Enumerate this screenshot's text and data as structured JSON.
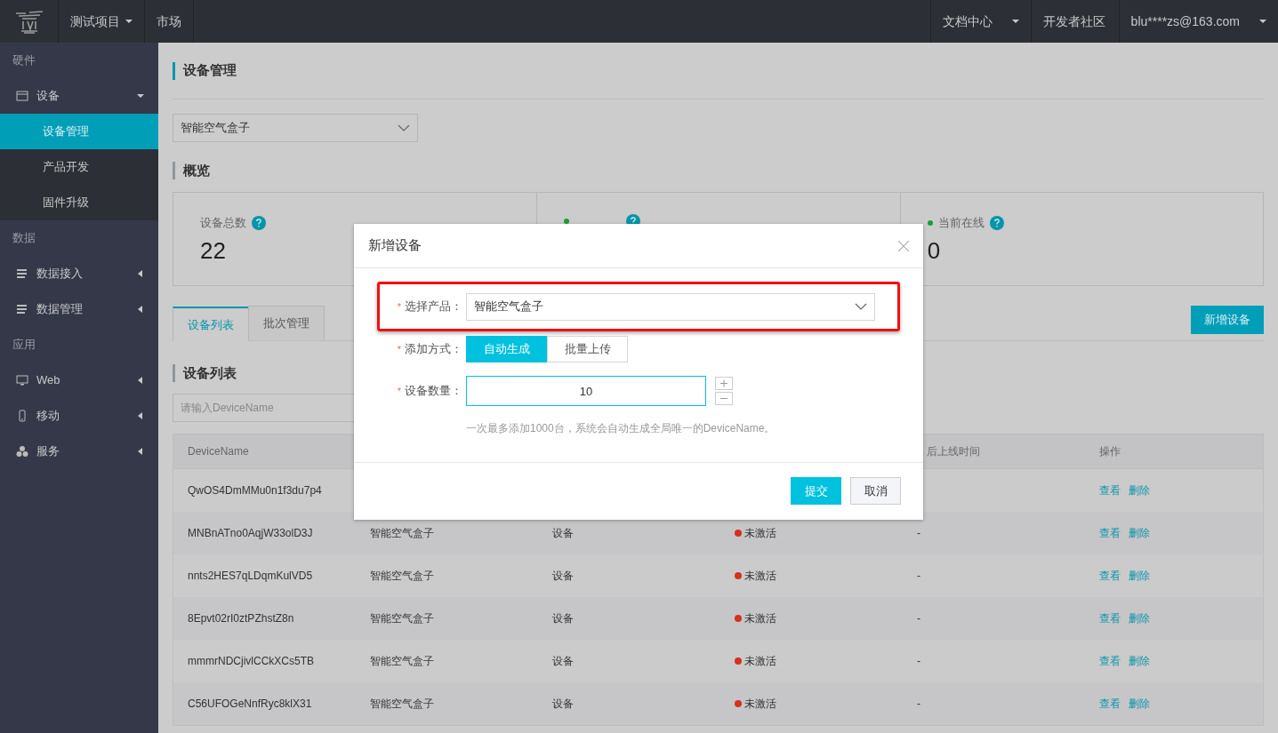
{
  "topbar": {
    "nav": [
      {
        "label": "测试项目",
        "dropdown": true
      },
      {
        "label": "市场",
        "dropdown": false
      }
    ],
    "right": [
      {
        "label": "文档中心",
        "dropdown": true
      },
      {
        "label": "开发者社区",
        "dropdown": false
      },
      {
        "label": "blu****zs@163.com",
        "dropdown": true
      }
    ]
  },
  "sidebar": {
    "sections": [
      {
        "title": "硬件",
        "items": [
          {
            "label": "设备",
            "kind": "window",
            "expanded": true,
            "children": [
              {
                "label": "设备管理",
                "selected": true
              },
              {
                "label": "产品开发",
                "selected": false
              },
              {
                "label": "固件升级",
                "selected": false
              }
            ]
          }
        ]
      },
      {
        "title": "数据",
        "items": [
          {
            "label": "数据接入",
            "kind": "list",
            "expanded": false
          },
          {
            "label": "数据管理",
            "kind": "list",
            "expanded": false
          }
        ]
      },
      {
        "title": "应用",
        "items": [
          {
            "label": "Web",
            "kind": "monitor",
            "expanded": false
          },
          {
            "label": "移动",
            "kind": "phone",
            "expanded": false
          },
          {
            "label": "服务",
            "kind": "cluster",
            "expanded": false
          }
        ]
      }
    ]
  },
  "page": {
    "title": "设备管理",
    "product_select": "智能空气盒子",
    "overview_title": "概览",
    "stats": [
      {
        "label": "设备总数",
        "value": "22"
      },
      {
        "color": "#17a03a"
      },
      {
        "label": "当前在线",
        "value": "0",
        "color": "#17a03a"
      }
    ],
    "tabs": [
      {
        "label": "设备列表",
        "selected": true
      },
      {
        "label": "批次管理",
        "selected": false
      }
    ],
    "add_button": "新增设备",
    "list_title": "设备列表",
    "search_placeholder": "请输入DeviceName",
    "table": {
      "columns": [
        "DeviceName",
        "",
        "",
        "",
        "后上线时间",
        "操作"
      ],
      "rows": [
        {
          "device_name": "QwOS4DmMMu0n1f3du7p4",
          "actions": [
            "查看",
            "删除"
          ]
        },
        {
          "device_name": "MNBnATno0AqjW33olD3J",
          "product": "智能空气盒子",
          "node_type": "设备",
          "status": "未激活",
          "color": "#d8301c",
          "last_online": "-",
          "actions": [
            "查看",
            "删除"
          ]
        },
        {
          "device_name": "nnts2HES7qLDqmKulVD5",
          "product": "智能空气盒子",
          "node_type": "设备",
          "status": "未激活",
          "color": "#d8301c",
          "last_online": "-",
          "actions": [
            "查看",
            "删除"
          ]
        },
        {
          "device_name": "8Epvt02rI0ztPZhstZ8n",
          "product": "智能空气盒子",
          "node_type": "设备",
          "status": "未激活",
          "color": "#d8301c",
          "last_online": "-",
          "actions": [
            "查看",
            "删除"
          ]
        },
        {
          "device_name": "mmmrNDCjivlCCkXCs5TB",
          "product": "智能空气盒子",
          "node_type": "设备",
          "status": "未激活",
          "color": "#d8301c",
          "last_online": "-",
          "actions": [
            "查看",
            "删除"
          ]
        },
        {
          "device_name": "C56UFOGeNnfRyc8klX31",
          "product": "智能空气盒子",
          "node_type": "设备",
          "status": "未激活",
          "color": "#d8301c",
          "last_online": "-",
          "actions": [
            "查看",
            "删除"
          ]
        }
      ]
    }
  },
  "dialog": {
    "title": "新增设备",
    "product_mark": "*",
    "product_label": "选择产品：",
    "product_value": "智能空气盒子",
    "method_mark": "*",
    "method_label": "添加方式：",
    "methods": [
      {
        "label": "自动生成",
        "selected": true
      },
      {
        "label": "批量上传",
        "selected": false
      }
    ],
    "quantity_mark": "*",
    "quantity_label": "设备数量：",
    "quantity_value": "10",
    "hint": "一次最多添加1000台，系统会自动生成全局唯一的DeviceName。",
    "buttons": [
      {
        "label": "提交",
        "kind": "primary"
      },
      {
        "label": "取消",
        "kind": "secondary"
      }
    ]
  }
}
